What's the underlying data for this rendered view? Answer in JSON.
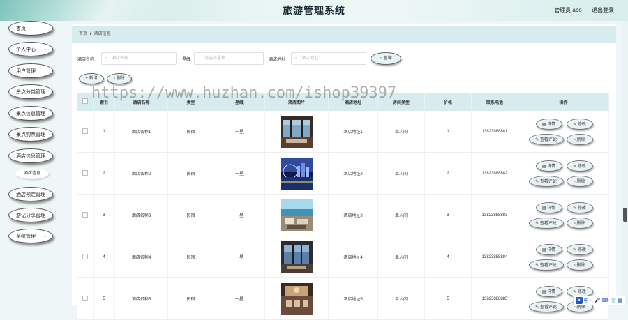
{
  "header": {
    "title": "旅游管理系统",
    "user_label": "管理员 abo",
    "logout_label": "退出登录"
  },
  "sidebar": {
    "items": [
      {
        "label": "首页",
        "has_arrow": false
      },
      {
        "label": "个人中心",
        "has_arrow": true
      },
      {
        "label": "用户管理",
        "has_arrow": false
      },
      {
        "label": "景点分类管理",
        "has_arrow": false
      },
      {
        "label": "景点信息管理",
        "has_arrow": false
      },
      {
        "label": "景点购票管理",
        "has_arrow": false
      },
      {
        "label": "酒店信息管理",
        "has_arrow": false
      },
      {
        "label": "酒店预定管理",
        "has_arrow": false
      },
      {
        "label": "游记分享管理",
        "has_arrow": false
      },
      {
        "label": "系统管理",
        "has_arrow": true
      }
    ],
    "sub_item": "酒店信息"
  },
  "breadcrumb": {
    "home": "首页",
    "separator": "/",
    "current": "酒店信息"
  },
  "search": {
    "name_label": "酒店名称",
    "name_placeholder": "酒店名称",
    "level_label": "星级",
    "level_placeholder": "请选择星级",
    "address_label": "酒店地址",
    "address_placeholder": "酒店地址",
    "query_label": "查询"
  },
  "actions": {
    "add_label": "新增",
    "delete_label": "删除"
  },
  "watermark": "https://www.huzhan.com/ishop39397",
  "table": {
    "columns": [
      "索引",
      "酒店名称",
      "类型",
      "星级",
      "酒店图片",
      "酒店地址",
      "房间类型",
      "价格",
      "联系电话",
      "操作"
    ],
    "rows": [
      {
        "index": "1",
        "name": "酒店名称1",
        "type": "民宿",
        "level": "一星",
        "address": "酒店地址1",
        "room": "单人间",
        "price": "1",
        "phone": "13823888881"
      },
      {
        "index": "2",
        "name": "酒店名称2",
        "type": "民宿",
        "level": "一星",
        "address": "酒店地址2",
        "room": "单人间",
        "price": "2",
        "phone": "13823888882"
      },
      {
        "index": "3",
        "name": "酒店名称3",
        "type": "民宿",
        "level": "一星",
        "address": "酒店地址3",
        "room": "单人间",
        "price": "3",
        "phone": "13823888883"
      },
      {
        "index": "4",
        "name": "酒店名称4",
        "type": "民宿",
        "level": "一星",
        "address": "酒店地址4",
        "room": "单人间",
        "price": "4",
        "phone": "13823888884"
      },
      {
        "index": "5",
        "name": "酒店名称5",
        "type": "民宿",
        "level": "一星",
        "address": "酒店地址5",
        "room": "单人间",
        "price": "5",
        "phone": "13823888885"
      }
    ],
    "op_detail": "详情",
    "op_edit": "修改",
    "op_review": "查看评论",
    "op_delete": "删除"
  },
  "ime": {
    "s": "S",
    "zh": "中",
    "punct": "·,",
    "mic": "🎤",
    "kbd": "⌨",
    "shirt": "👕",
    "grid": "▦"
  }
}
